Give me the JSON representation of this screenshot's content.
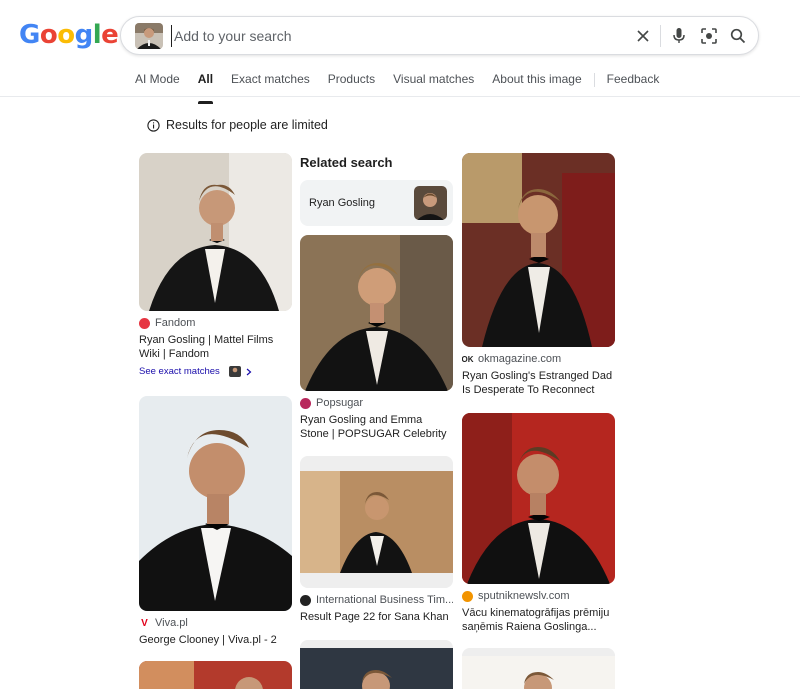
{
  "logo": {
    "g1": "G",
    "o1": "o",
    "o2": "o",
    "g2": "g",
    "l": "l",
    "e": "e"
  },
  "search": {
    "placeholder": "Add to your search"
  },
  "tabs": [
    {
      "label": "AI Mode"
    },
    {
      "label": "All",
      "active": true
    },
    {
      "label": "Exact matches"
    },
    {
      "label": "Products"
    },
    {
      "label": "Visual matches"
    },
    {
      "label": "About this image"
    },
    {
      "label": "Feedback"
    }
  ],
  "notice": {
    "text": "Results for people are limited"
  },
  "related": {
    "heading": "Related search",
    "chip_label": "Ryan Gosling"
  },
  "results": {
    "fandom": {
      "source": "Fandom",
      "title": "Ryan Gosling | Mattel Films Wiki | Fandom",
      "exact_link": "See exact matches"
    },
    "viva": {
      "source": "Viva.pl",
      "title": "George Clooney | Viva.pl - 2"
    },
    "popsugar": {
      "source": "Popsugar",
      "title": "Ryan Gosling and Emma Stone | POPSUGAR Celebrity"
    },
    "ibt": {
      "source": "International Business Tim...",
      "title": "Result Page 22 for Sana Khan"
    },
    "okmagazine": {
      "source": "okmagazine.com",
      "title": "Ryan Gosling's Estranged Dad Is Desperate To Reconnect"
    },
    "sputnik": {
      "source": "sputniknewslv.com",
      "title": "Vācu kinematogrāfijas prēmiju saņēmis Raiena Goslinga..."
    }
  },
  "colors": {
    "accent": "#1a0dab",
    "text": "#1f1f1f",
    "muted": "#4d5156"
  },
  "icons": [
    "search-icon",
    "camera-lens-icon",
    "microphone-icon",
    "clear-icon",
    "info-icon"
  ]
}
